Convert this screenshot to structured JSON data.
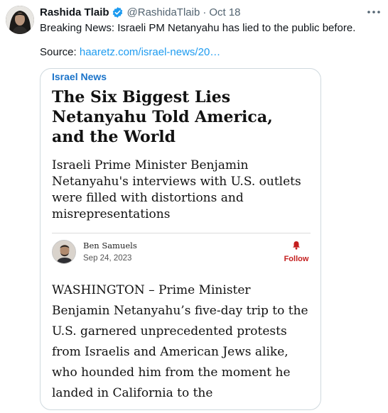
{
  "tweet": {
    "author_name": "Rashida Tlaib",
    "handle": "@RashidaTlaib",
    "separator": "·",
    "date": "Oct 18",
    "text": "Breaking News: Israeli PM Netanyahu has lied to the public before.",
    "source_label": "Source: ",
    "source_link": "haaretz.com/israel-news/20…"
  },
  "card": {
    "section": "Israel News",
    "headline": "The Six Biggest Lies Netanyahu Told America, and the World",
    "subheadline": "Israeli Prime Minister Benjamin Netanyahu's interviews with U.S. outlets were filled with distortions and misrepresentations",
    "author": "Ben Samuels",
    "date": "Sep 24, 2023",
    "follow_label": "Follow",
    "body": "WASHINGTON – Prime Minister Benjamin Netanyahu’s five-day trip to the U.S. garnered unprecedented protests from Israelis and American Jews alike, who hounded him from the moment he landed in California to the"
  },
  "colors": {
    "verified_badge": "#1d9bf0",
    "link": "#1d9bf0",
    "section_label": "#1a73c9",
    "follow": "#c41e1e",
    "muted_text": "#536471"
  },
  "icons": {
    "more": "more-horizontal-icon",
    "verified": "verified-badge-icon",
    "follow": "bell-icon"
  }
}
